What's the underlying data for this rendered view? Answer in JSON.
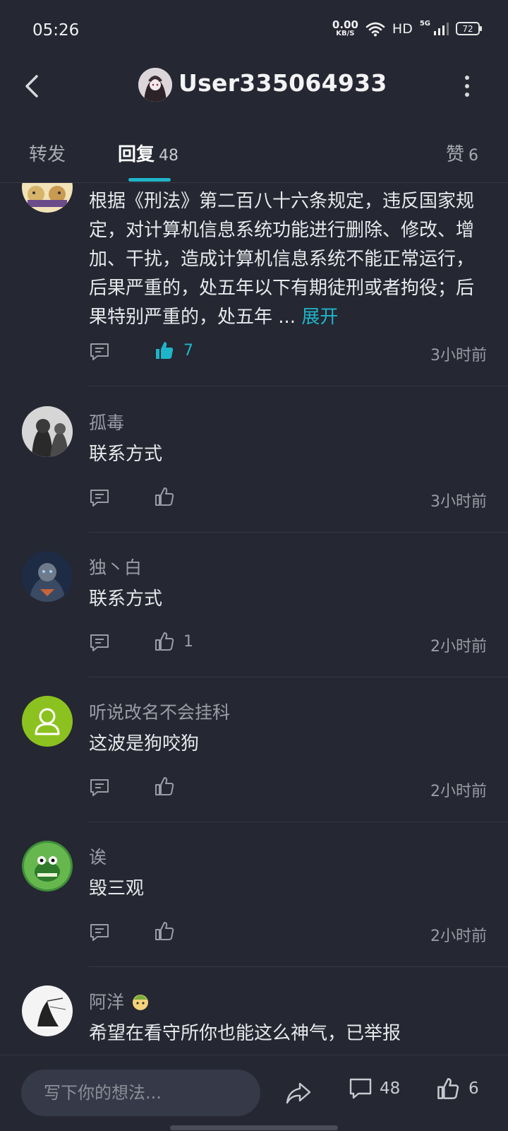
{
  "status_bar": {
    "time": "05:26",
    "net_speed_value": "0.00",
    "net_speed_unit": "KB/S",
    "hd": "HD",
    "network": "5G",
    "battery": "72"
  },
  "header": {
    "title": "User335064933"
  },
  "tabs": [
    {
      "label": "转发",
      "count": ""
    },
    {
      "label": "回复",
      "count": "48"
    },
    {
      "label": "赞",
      "count": "6"
    }
  ],
  "comments": [
    {
      "user": "",
      "text": "根据《刑法》第二百八十六条规定，违反国家规定，对计算机信息系统功能进行删除、修改、增加、干扰，造成计算机信息系统不能正常运行，后果严重的，处五年以下有期徒刑或者拘役；后果特别严重的，处五年 ...",
      "expand": "展开",
      "likes": "7",
      "time": "3小时前",
      "liked": true
    },
    {
      "user": "孤毒",
      "text": "联系方式",
      "likes": "",
      "time": "3小时前"
    },
    {
      "user": "独丶白",
      "text": "联系方式",
      "likes": "1",
      "time": "2小时前"
    },
    {
      "user": "听说改名不会挂科",
      "text": "这波是狗咬狗",
      "likes": "",
      "time": "2小时前"
    },
    {
      "user": "诶",
      "text": "毁三观",
      "likes": "",
      "time": "2小时前"
    },
    {
      "user": "阿洋",
      "text": "希望在看守所你也能这么神气，已举报",
      "likes": "",
      "time": ""
    }
  ],
  "bottom_bar": {
    "placeholder": "写下你的想法...",
    "reply_count": "48",
    "like_count": "6"
  },
  "colors": {
    "background": "#252732",
    "accent": "#1fb5c8",
    "muted_text": "#9a9da6",
    "default_avatar": "#8cc21f"
  }
}
